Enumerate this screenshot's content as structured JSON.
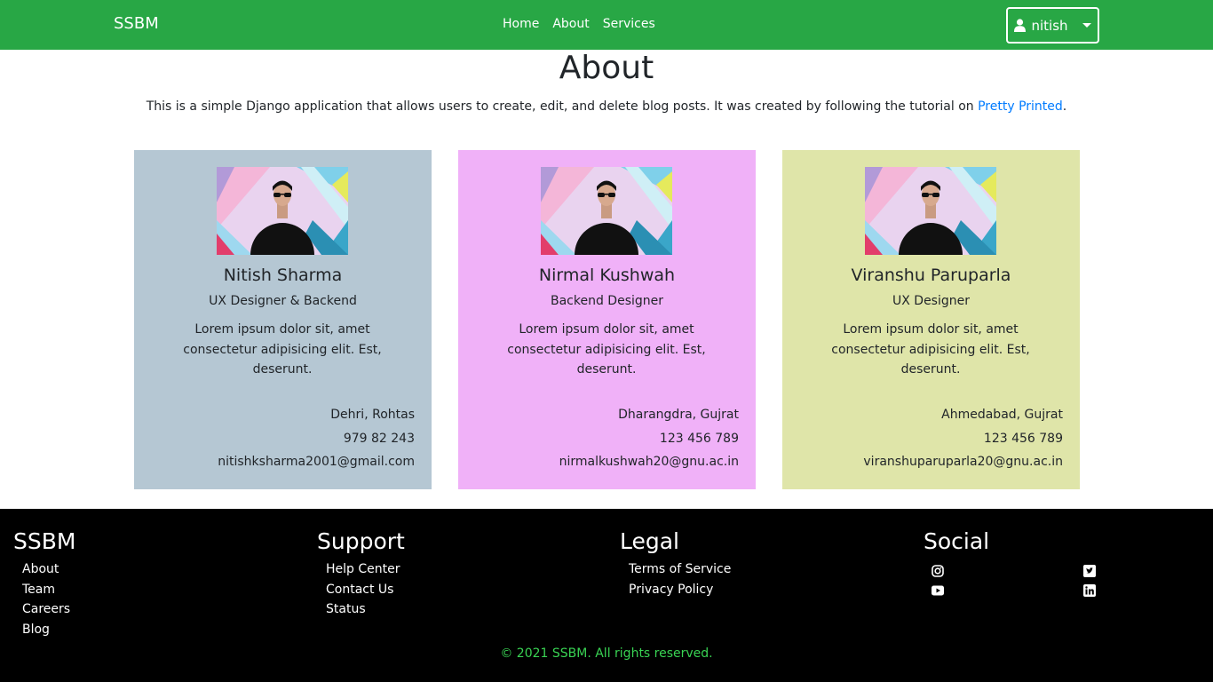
{
  "navbar": {
    "brand": "SSBM",
    "links": [
      "Home",
      "About",
      "Services"
    ],
    "user": "nitish"
  },
  "main": {
    "title": "About",
    "intro_text": "This is a simple Django application that allows users to create, edit, and delete blog posts. It was created by following the tutorial on ",
    "intro_link": "Pretty Printed",
    "intro_end": "."
  },
  "team": [
    {
      "name": "Nitish Sharma",
      "role": "UX Designer & Backend",
      "description": "Lorem ipsum dolor sit, amet consectetur adipisicing elit. Est, deserunt.",
      "location": "Dehri, Rohtas",
      "phone": "979 82 243",
      "email": "nitishksharma2001@gmail.com",
      "bg": "#b5c7d3"
    },
    {
      "name": "Nirmal Kushwah",
      "role": "Backend Designer",
      "description": "Lorem ipsum dolor sit, amet consectetur adipisicing elit. Est, deserunt.",
      "location": "Dharangdra, Gujrat",
      "phone": "123 456 789",
      "email": "nirmalkushwah20@gnu.ac.in",
      "bg": "#f0b1f8"
    },
    {
      "name": "Viranshu Paruparla",
      "role": "UX Designer",
      "description": "Lorem ipsum dolor sit, amet consectetur adipisicing elit. Est, deserunt.",
      "location": "Ahmedabad, Gujrat",
      "phone": "123 456 789",
      "email": "viranshuparuparla20@gnu.ac.in",
      "bg": "#dfe5a9"
    }
  ],
  "footer": {
    "columns": [
      {
        "title": "SSBM",
        "links": [
          "About",
          "Team",
          "Careers",
          "Blog"
        ]
      },
      {
        "title": "Support",
        "links": [
          "Help Center",
          "Contact Us",
          "Status"
        ]
      },
      {
        "title": "Legal",
        "links": [
          "Terms of Service",
          "Privacy Policy"
        ]
      }
    ],
    "social_title": "Social",
    "social_icons": [
      "instagram-icon",
      "twitter-icon",
      "youtube-icon",
      "linkedin-icon"
    ],
    "copyright": "© 2021 SSBM. All rights reserved.",
    "copyright_color": "#39d353"
  },
  "colors": {
    "navbar_bg": "#28a745",
    "link": "#007bff",
    "footer_bg": "#000000"
  }
}
